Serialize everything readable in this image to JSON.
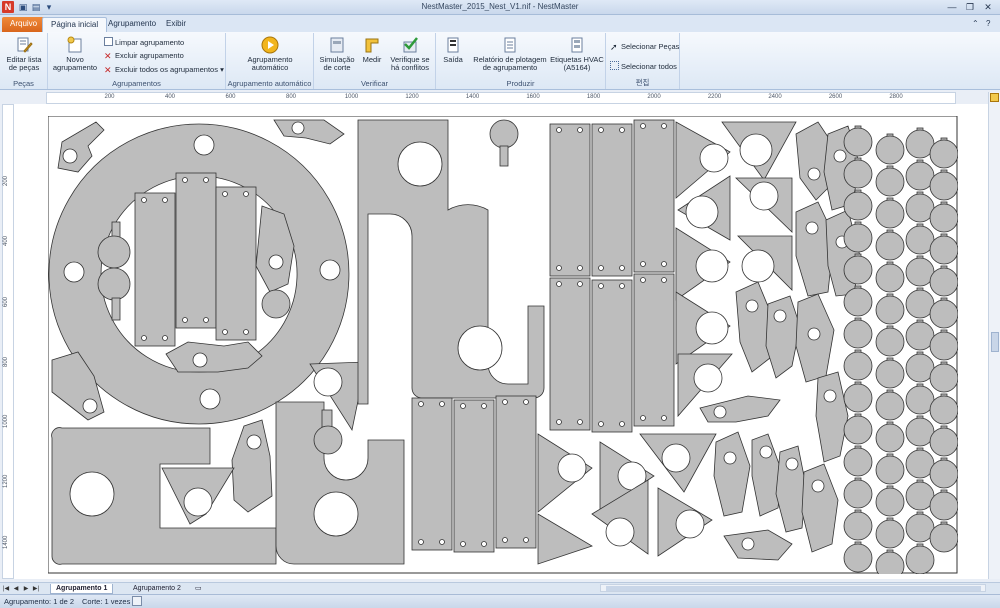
{
  "window": {
    "title": "NestMaster_2015_Nest_V1.nif - NestMaster",
    "app_icon": "N",
    "minimize": "—",
    "restore": "❐",
    "close": "✕"
  },
  "tabs": [
    "Arquivo",
    "Página inicial",
    "Agrupamento",
    "Exibir"
  ],
  "ribbon": {
    "groups": {
      "pecas": {
        "label": "Peças",
        "edit_parts_label": "Editar lista de peças"
      },
      "agrupamentos": {
        "label": "Agrupamentos",
        "new_nest_label": "Novo agrupamento",
        "clear_nest": "Limpar agrupamento",
        "delete_nest": "Excluir agrupamento",
        "delete_all": "Excluir todos os agrupamentos"
      },
      "auto": {
        "label": "Agrupamento automático",
        "auto_nest_label": "Agrupamento automático"
      },
      "verificar": {
        "label": "Verificar",
        "cut_sim": "Simulação de corte",
        "measure": "Medir",
        "check_conflicts": "Verifique se há conflitos"
      },
      "produzir": {
        "label": "Produzir",
        "output": "Saída",
        "plot_report": "Relatório de plotagem de agrupamento",
        "hvac_labels": "Etiquetas HVAC (A5164)"
      },
      "selection": {
        "label": "편집",
        "select_parts": "Selecionar Peças",
        "select_all": "Selecionar todos"
      }
    }
  },
  "ruler": {
    "h_ticks": [
      "200",
      "400",
      "600",
      "800",
      "1000",
      "1200",
      "1400",
      "1600",
      "1800",
      "2000",
      "2200",
      "2400",
      "2600",
      "2800"
    ],
    "v_ticks": [
      "200",
      "400",
      "600",
      "800",
      "1000",
      "1200",
      "1400"
    ]
  },
  "sheet_tabs": {
    "tab1": "Agrupamento 1",
    "tab2": "Agrupamento 2"
  },
  "status": {
    "nest": "Agrupamento: 1 de 2",
    "cut": "Corte: 1 vezes"
  },
  "colors": {
    "part_fill": "#bdbdbd",
    "part_stroke": "#333333",
    "file_tab": "#e0762a"
  }
}
